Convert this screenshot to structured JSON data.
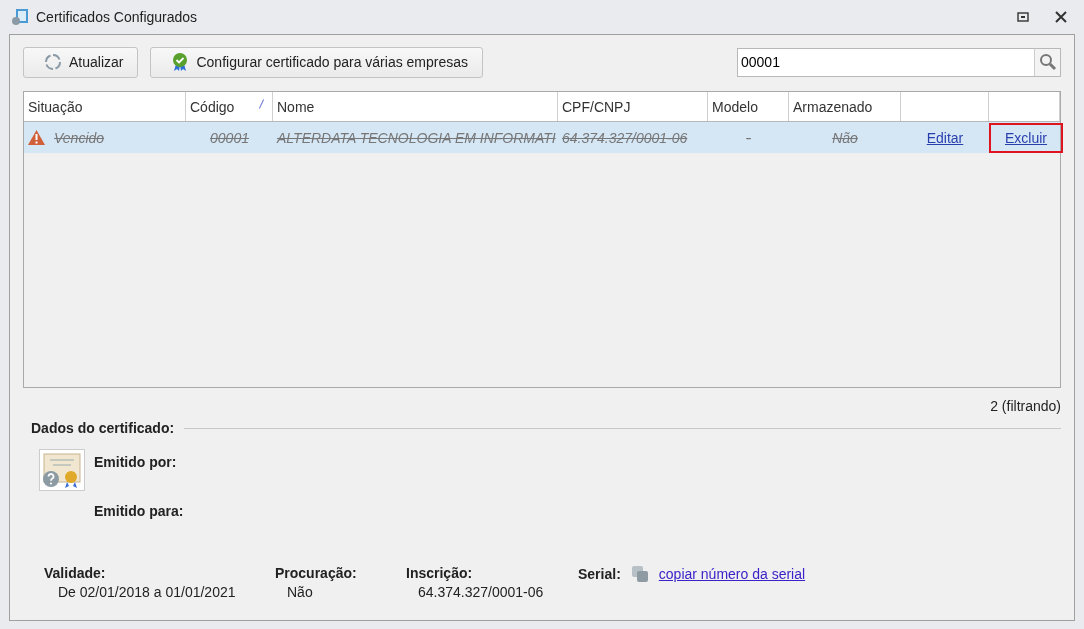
{
  "window": {
    "title": "Certificados Configurados"
  },
  "toolbar": {
    "buttons": [
      {
        "label": "Atualizar",
        "kind": "refresh"
      },
      {
        "label": "Configurar certificado para várias empresas",
        "kind": "badge"
      }
    ],
    "search": {
      "value": "00001"
    }
  },
  "table": {
    "columns": [
      {
        "label": "Situação",
        "sorted": false
      },
      {
        "label": "Código",
        "sorted": true
      },
      {
        "label": "Nome",
        "sorted": false
      },
      {
        "label": "CPF/CNPJ",
        "sorted": false
      },
      {
        "label": "Modelo",
        "sorted": false
      },
      {
        "label": "Armazenado",
        "sorted": false
      },
      {
        "sorted": false
      },
      {
        "sorted": false
      }
    ],
    "rows": [
      {
        "selected": true,
        "expired": true,
        "situacao": "Vencido",
        "codigo": "00001",
        "nome": "ALTERDATA TECNOLOGIA EM INFORMATI",
        "cpf_cnpj": "64.374.327/0001-06",
        "modelo": "-",
        "armazenado": "Não",
        "actions": [
          {
            "label": "Editar",
            "highlighted": false
          },
          {
            "label": "Excluir",
            "highlighted": true
          }
        ]
      }
    ]
  },
  "count": "2 (filtrando)",
  "details": {
    "title": "Dados do certificado:",
    "emitido_por": "Emitido por:",
    "emitido_para": "Emitido para:",
    "fields": [
      {
        "label": "Validade:",
        "value": "De 02/01/2018 a 01/01/2021"
      },
      {
        "label": "Procuração:",
        "value": "Não"
      },
      {
        "label": "Inscrição:",
        "value": "64.374.327/0001-06"
      }
    ],
    "serial": {
      "label": "Serial:",
      "link": "copiar número da serial"
    }
  }
}
